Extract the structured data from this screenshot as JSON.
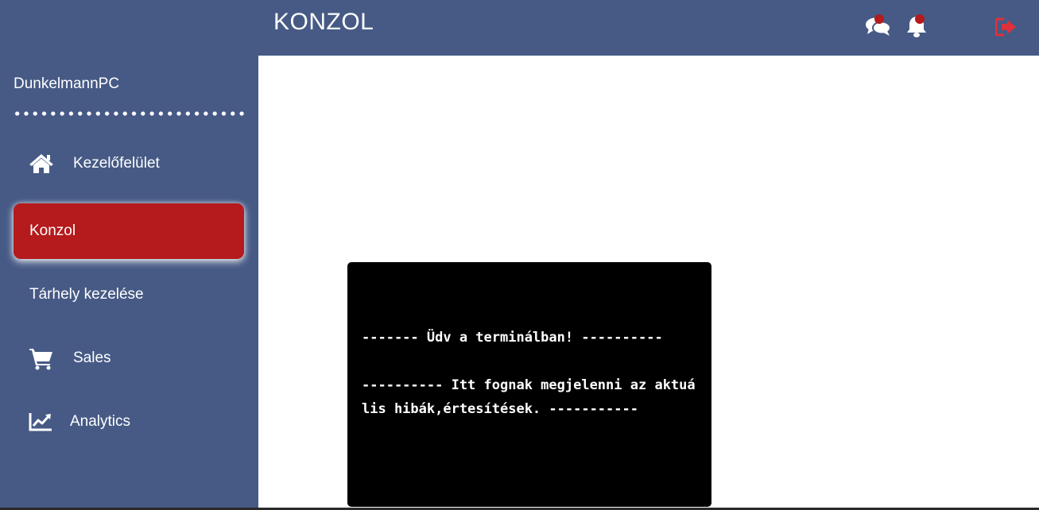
{
  "header": {
    "title": "KONZOL",
    "icons": {
      "chat": "chat-icon",
      "notifications": "bell-icon",
      "logout": "logout-icon"
    },
    "badge_color": "#b51a1c",
    "logout_color": "#e0303a"
  },
  "sidebar": {
    "username": "DunkelmannPC",
    "background": "#465a85",
    "items": [
      {
        "label": "Kezelőfelület",
        "icon": "home-icon",
        "active": false
      },
      {
        "label": "Konzol",
        "icon": "",
        "active": true
      },
      {
        "label": "Tárhely kezelése",
        "icon": "",
        "active": false
      },
      {
        "label": "Sales",
        "icon": "cart-icon",
        "active": false
      },
      {
        "label": "Analytics",
        "icon": "chart-line-icon",
        "active": false
      }
    ],
    "active_color": "#b51a1c"
  },
  "terminal": {
    "lines": [
      "------- Üdv a terminálban! ----------",
      "---------- Itt fognak megjelenni az aktuális hibák,értesítések. -----------"
    ]
  }
}
